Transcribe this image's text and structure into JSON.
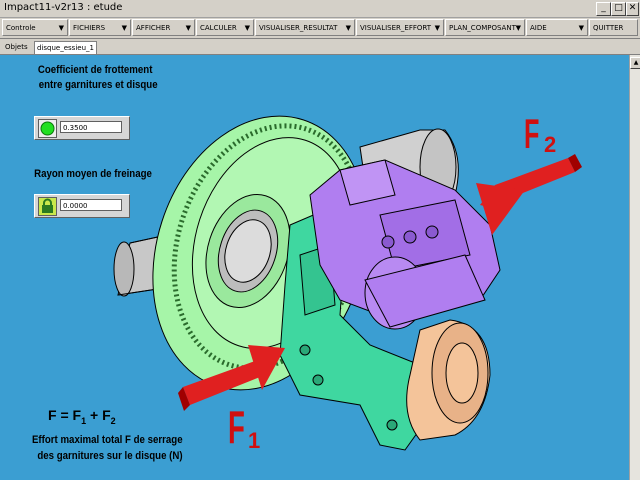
{
  "window": {
    "title": "Impact11-v2r13 : etude"
  },
  "menu": [
    {
      "label": "Controle"
    },
    {
      "label": "FICHIERS"
    },
    {
      "label": "AFFICHER"
    },
    {
      "label": "CALCULER"
    },
    {
      "label": "VISUALISER_RESULTAT"
    },
    {
      "label": "VISUALISER_EFFORT"
    },
    {
      "label": "PLAN_COMPOSANT"
    },
    {
      "label": "AIDE"
    },
    {
      "label": "QUITTER"
    }
  ],
  "tabs": [
    {
      "label": "Objets"
    },
    {
      "label": "disque_essieu_1"
    }
  ],
  "params": {
    "friction_title_1": "Coefficient de frottement",
    "friction_title_2": "entre garnitures et disque",
    "friction_value": "0.3500",
    "radius_title": "Rayon moyen de freinage",
    "radius_value": "0.0000"
  },
  "annotations": {
    "f2_main": "F",
    "f2_sub": "2",
    "f1_main": "F",
    "f1_sub": "1",
    "formula_lhs": "F =",
    "formula_f1": "F",
    "formula_f1_sub": "1",
    "formula_plus": "+",
    "formula_f2": "F",
    "formula_f2_sub": "2",
    "effort_1": "Effort maximal total F de serrage",
    "effort_2": "des garnitures sur le disque (N)"
  },
  "colors": {
    "viewport_bg": "#3b9ed2",
    "disc": "#a6f5a8",
    "caliper": "#b07ef0",
    "bracket": "#3fd7a0",
    "axle": "#c8c8c8",
    "hub": "#f4c49a",
    "arrow": "#e02020",
    "force_label": "#d01010"
  },
  "icons": {
    "friction": "green-circle-icon",
    "radius": "lock-icon"
  }
}
